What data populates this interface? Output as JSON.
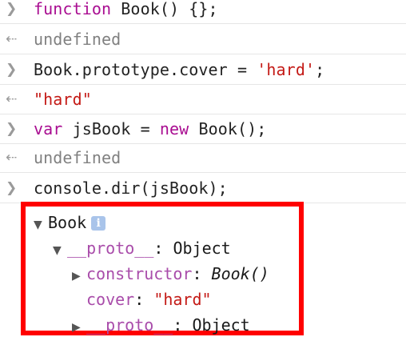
{
  "console": {
    "prompt_icon": "chevron-right-icon",
    "return_icon": "return-arrow-icon",
    "lines": [
      {
        "type": "input",
        "parts": [
          "function",
          " Book() {};"
        ]
      },
      {
        "type": "output",
        "text": "undefined"
      },
      {
        "type": "input",
        "parts": [
          "Book.prototype.cover = ",
          "'hard'",
          ";"
        ]
      },
      {
        "type": "output",
        "text": "\"hard\""
      },
      {
        "type": "input",
        "parts": [
          "var",
          " jsBook = ",
          "new",
          " Book();"
        ]
      },
      {
        "type": "output",
        "text": "undefined"
      },
      {
        "type": "input",
        "parts": [
          "console.dir(jsBook);"
        ]
      }
    ]
  },
  "tree": {
    "root": {
      "label": "Book",
      "info_icon": "i"
    },
    "proto": {
      "key": "__proto__",
      "sep": ": ",
      "value": "Object"
    },
    "constructor": {
      "key": "constructor",
      "sep": ": ",
      "value": "Book()"
    },
    "cover": {
      "key": "cover",
      "sep": ": ",
      "value": "\"hard\""
    },
    "proto2": {
      "key": "__proto__",
      "sep": ": ",
      "value": "Object"
    }
  },
  "colors": {
    "highlight_border": "#ff0000",
    "keyword": "#a90d91",
    "string": "#c41a16",
    "property": "#a94caa"
  }
}
